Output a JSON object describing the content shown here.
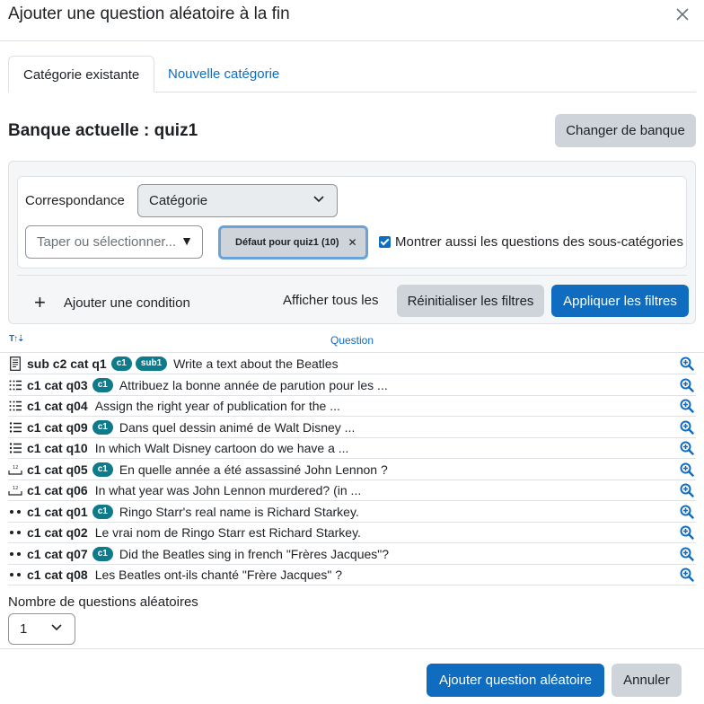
{
  "modal": {
    "title": "Ajouter une question aléatoire à la fin"
  },
  "tabs": [
    {
      "label": "Catégorie existante",
      "active": true
    },
    {
      "label": "Nouvelle catégorie",
      "active": false
    }
  ],
  "bank": {
    "title": "Banque actuelle : quiz1",
    "change_label": "Changer de banque"
  },
  "filter": {
    "match_label": "Correspondance",
    "match_value": "Catégorie",
    "typeahead_placeholder": "Taper ou sélectionner...",
    "selected_chip": "Défaut pour quiz1 (10)",
    "subcat_label": "Montrer aussi les questions des sous-catégories",
    "subcat_checked": true,
    "add_condition": "Ajouter une condition",
    "show_all": "Afficher tous les",
    "reset": "Réinitialiser les filtres",
    "apply": "Appliquer les filtres"
  },
  "table": {
    "column_question": "Question",
    "rows": [
      {
        "type": "essay-icon",
        "name": "sub c2 cat q1",
        "badges": [
          "c1",
          "sub1"
        ],
        "text": "Write a text about the Beatles"
      },
      {
        "type": "ordering-icon",
        "name": "c1 cat q03",
        "badges": [
          "c1"
        ],
        "text": "Attribuez la bonne année de parution pour les ..."
      },
      {
        "type": "ordering-icon",
        "name": "c1 cat q04",
        "badges": [],
        "text": "Assign the right year of publication for the ..."
      },
      {
        "type": "multichoice-icon",
        "name": "c1 cat q09",
        "badges": [
          "c1"
        ],
        "text": "Dans quel dessin animé de Walt Disney ..."
      },
      {
        "type": "multichoice-icon",
        "name": "c1 cat q10",
        "badges": [],
        "text": "In which Walt Disney cartoon do we have a ..."
      },
      {
        "type": "numerical-icon",
        "name": "c1 cat q05",
        "badges": [
          "c1"
        ],
        "text": "En quelle année a été assassiné John Lennon ?"
      },
      {
        "type": "numerical-icon",
        "name": "c1 cat q06",
        "badges": [],
        "text": "In what year was John Lennon murdered? (in ..."
      },
      {
        "type": "truefalse-icon",
        "name": "c1 cat q01",
        "badges": [
          "c1"
        ],
        "text": "Ringo Starr's real name is Richard Starkey."
      },
      {
        "type": "truefalse-icon",
        "name": "c1 cat q02",
        "badges": [],
        "text": "Le vrai nom de Ringo Starr est Richard Starkey."
      },
      {
        "type": "truefalse-icon",
        "name": "c1 cat q07",
        "badges": [
          "c1"
        ],
        "text": "Did the Beatles sing in french \"Frères Jacques\"?"
      },
      {
        "type": "truefalse-icon",
        "name": "c1 cat q08",
        "badges": [],
        "text": "Les Beatles ont-ils chanté \"Frère Jacques\" ?"
      }
    ]
  },
  "random_count": {
    "label": "Nombre de questions aléatoires",
    "value": "1"
  },
  "footer": {
    "add_label": "Ajouter question aléatoire",
    "cancel_label": "Annuler"
  },
  "colors": {
    "primary": "#0f6cbf",
    "badge": "#0f7b8a",
    "secondary": "#ced4da"
  }
}
